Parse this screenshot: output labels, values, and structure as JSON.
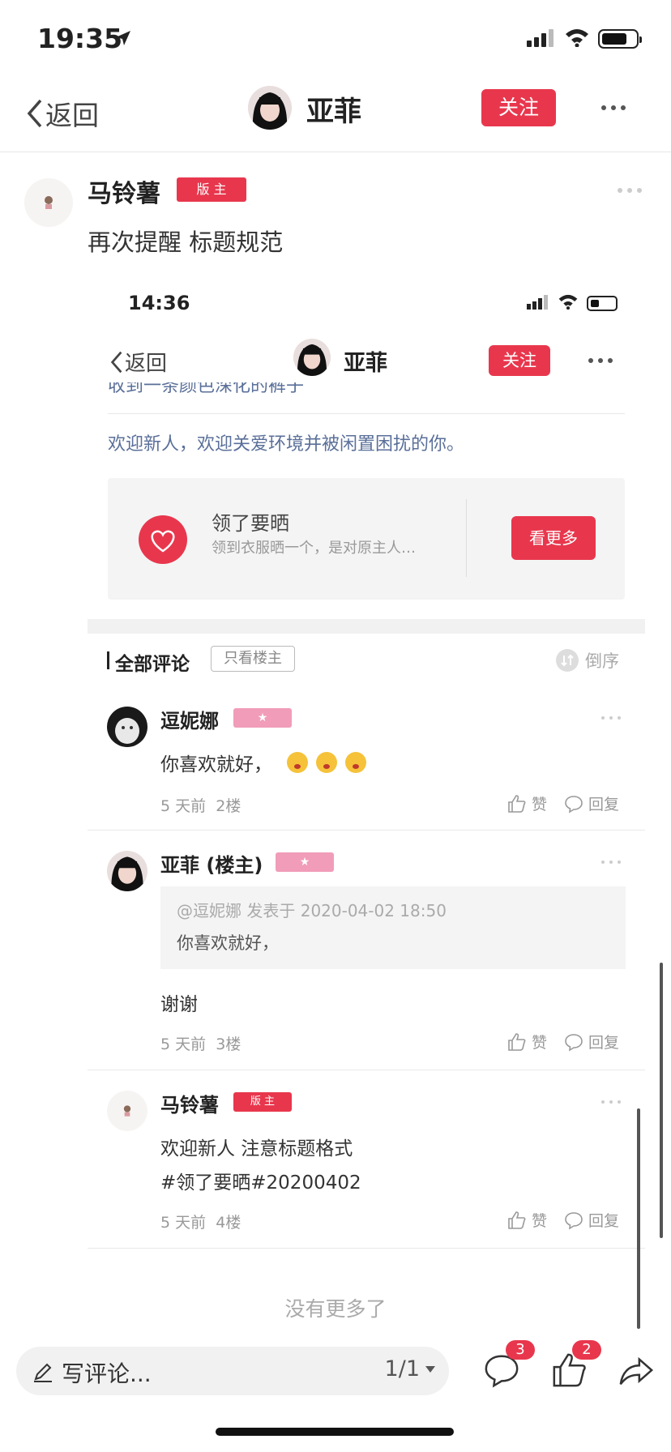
{
  "status_bar": {
    "time": "19:35"
  },
  "nav": {
    "back_label": "返回",
    "user_name": "亚菲",
    "follow_label": "关注"
  },
  "post": {
    "author": "马铃薯",
    "badge": "版 主",
    "text": "再次提醒 标题规范"
  },
  "embedded_screenshot": {
    "time": "14:36",
    "nav": {
      "back_label": "返回",
      "user_name": "亚菲",
      "follow_label": "关注"
    },
    "partial_line": "收到一条颜色深化的裤子",
    "welcome_text": "欢迎新人，欢迎关爱环境并被闲置困扰的你。",
    "card": {
      "title": "领了要晒",
      "subtitle": "领到衣服晒一个，是对原主人…",
      "button_label": "看更多"
    },
    "comments_header": {
      "title": "全部评论",
      "only_host_label": "只看楼主",
      "order_label": "倒序"
    },
    "comments": [
      {
        "name": "逗妮娜",
        "text": "你喜欢就好，",
        "time": "5 天前",
        "floor": "2楼",
        "like_label": "赞",
        "reply_label": "回复",
        "star": "★"
      },
      {
        "name": "亚菲 (楼主)",
        "quote_header": "@逗妮娜 发表于 2020-04-02 18:50",
        "quote_text": "你喜欢就好，",
        "text": "谢谢",
        "time": "5 天前",
        "floor": "3楼",
        "like_label": "赞",
        "reply_label": "回复",
        "star": "★"
      },
      {
        "name": "马铃薯",
        "badge": "版 主",
        "text_line1": "欢迎新人 注意标题格式",
        "text_line2": "#领了要晒#20200402",
        "time": "5 天前",
        "floor": "4楼",
        "like_label": "赞",
        "reply_label": "回复"
      }
    ],
    "no_more_label": "没有更多了"
  },
  "bottom_bar": {
    "comment_placeholder": "写评论...",
    "pager": "1/1",
    "comment_count": "3",
    "like_count": "2"
  },
  "colors": {
    "accent": "#e8374d",
    "link": "#5a6f99",
    "pink_badge": "#f19cb9"
  },
  "icons": [
    "location-arrow-icon",
    "signal-icon",
    "wifi-icon",
    "battery-icon",
    "chevron-left-icon",
    "more-icon",
    "heart-icon",
    "sort-icon",
    "thumbs-up-icon",
    "comment-icon",
    "pencil-icon",
    "share-icon",
    "caret-down-icon"
  ]
}
